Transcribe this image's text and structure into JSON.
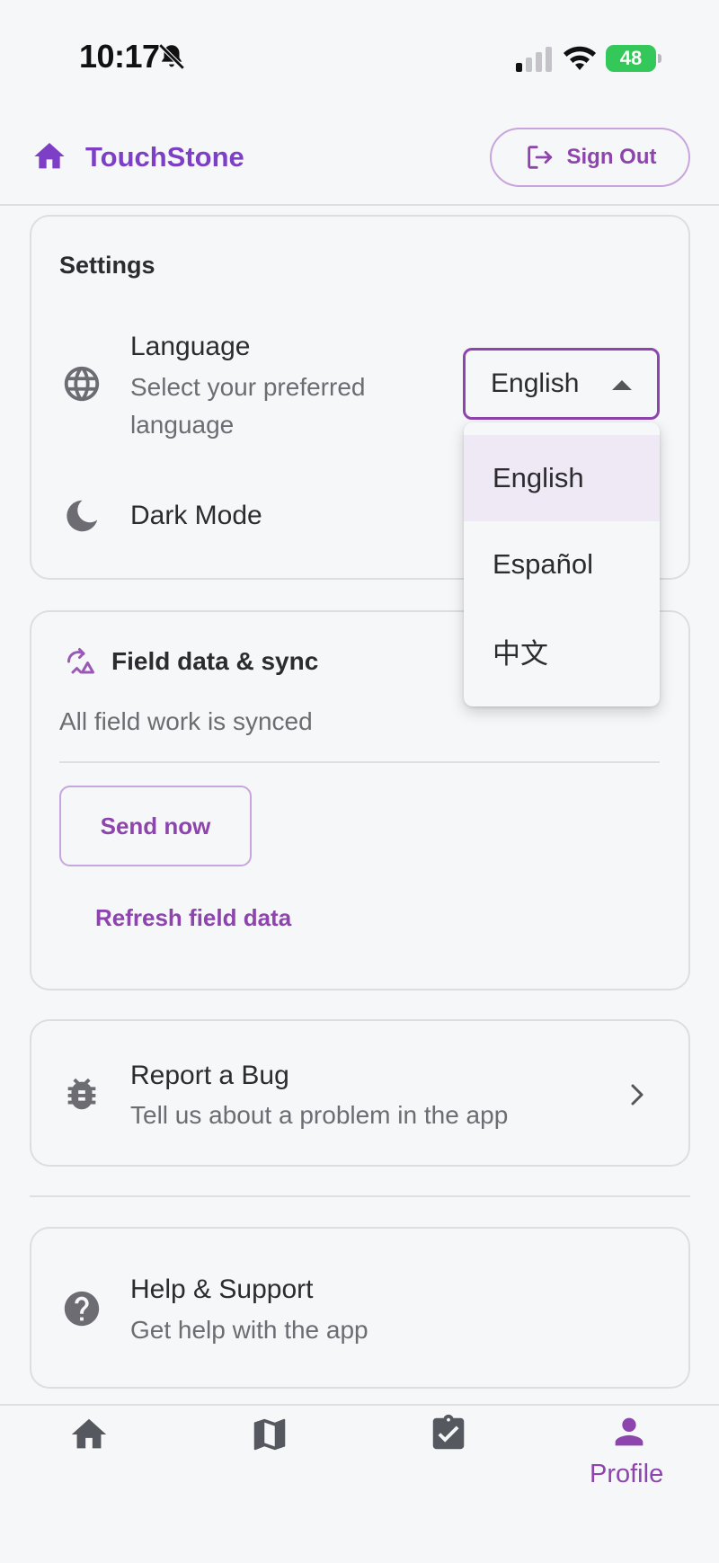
{
  "status_bar": {
    "time": "10:17",
    "battery": "48"
  },
  "header": {
    "app_title": "TouchStone",
    "sign_out_label": "Sign Out"
  },
  "settings": {
    "title": "Settings",
    "language": {
      "title": "Language",
      "subtitle_line1": "Select your preferred",
      "subtitle_line2": "language",
      "selected_value": "English"
    },
    "language_options": [
      "English",
      "Español",
      "中文"
    ],
    "dark_mode": {
      "title": "Dark Mode"
    }
  },
  "sync": {
    "title": "Field data & sync",
    "status": "All field work is synced",
    "send_label": "Send now",
    "refresh_label": "Refresh field data"
  },
  "bug": {
    "title": "Report a Bug",
    "subtitle": "Tell us about a problem in the app"
  },
  "help": {
    "title": "Help & Support",
    "subtitle": "Get help with the app"
  },
  "bottom_nav": {
    "active_label": "Profile"
  },
  "colors": {
    "accent": "#8e44ad",
    "title_purple": "#7e3fc7",
    "selected_bg": "#efe9f5",
    "battery_green": "#34c759"
  }
}
